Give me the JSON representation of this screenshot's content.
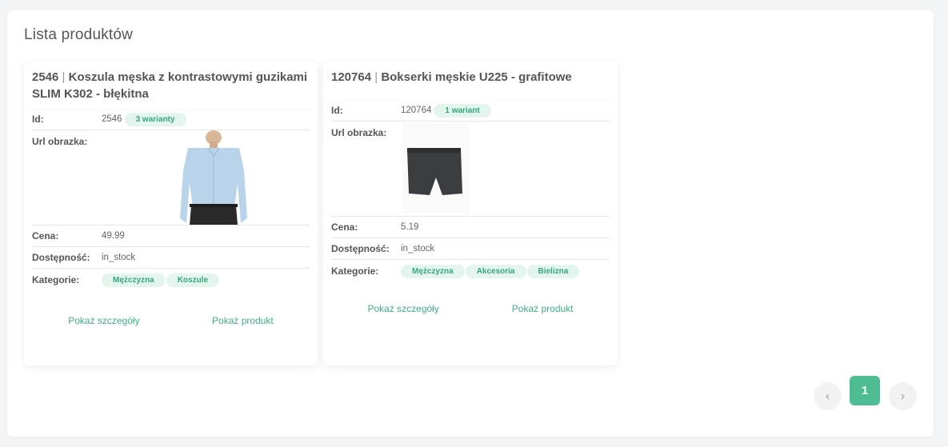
{
  "page": {
    "title": "Lista produktów"
  },
  "products": [
    {
      "id_prefix": "2546",
      "separator": "|",
      "name": "Koszula męska z kontrastowymi guzikami SLIM K302 - błękitna",
      "labels": {
        "id": "Id:",
        "image": "Url obrazka:",
        "price": "Cena:",
        "availability": "Dostępność:",
        "categories": "Kategorie:"
      },
      "id": "2546",
      "variants": "3 warianty",
      "price": "49.99",
      "availability": "in_stock",
      "categories": [
        "Mężczyzna",
        "Koszule"
      ],
      "links": {
        "details": "Pokaż szczegóły",
        "product": "Pokaż produkt"
      }
    },
    {
      "id_prefix": "120764",
      "separator": "|",
      "name": "Bokserki męskie U225 - grafitowe",
      "labels": {
        "id": "Id:",
        "image": "Url obrazka:",
        "price": "Cena:",
        "availability": "Dostępność:",
        "categories": "Kategorie:"
      },
      "id": "120764",
      "variants": "1 wariant",
      "price": "5.19",
      "availability": "in_stock",
      "categories": [
        "Mężczyzna",
        "Akcesoria",
        "Bielizna"
      ],
      "links": {
        "details": "Pokaż szczegóły",
        "product": "Pokaż produkt"
      }
    }
  ],
  "pagination": {
    "prev": "‹",
    "current": "1",
    "next": "›"
  },
  "colors": {
    "accent": "#4fbd94",
    "badge_bg": "#e4f5ee",
    "badge_text": "#35a878",
    "link": "#3fae87"
  }
}
